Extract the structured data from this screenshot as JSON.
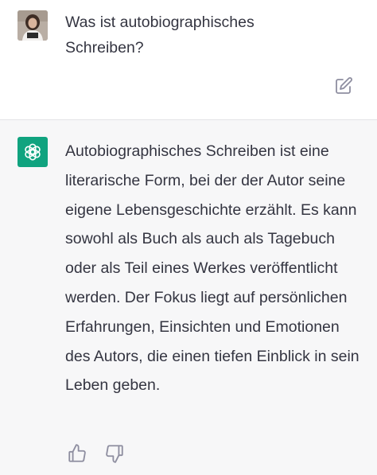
{
  "conversation": {
    "user_message": {
      "text": "Was ist autobiographisches\nSchreiben?",
      "avatar_icon": "user-photo-avatar",
      "edit_icon": "pencil-square-icon"
    },
    "assistant_message": {
      "text": "Autobiographisches Schreiben ist eine literarische Form, bei der der Autor seine eigene Lebensgeschichte erzählt. Es kann sowohl als Buch als auch als Tagebuch oder als Teil eines Werkes veröffentlicht werden. Der Fokus liegt auf persönlichen Erfahrungen, Einsichten und Emotionen des Autors, die einen tiefen Einblick in sein Leben geben.",
      "avatar_icon": "openai-logo-icon",
      "feedback": {
        "like_icon": "thumbs-up-icon",
        "dislike_icon": "thumbs-down-icon"
      }
    }
  },
  "colors": {
    "assistant_background": "#f7f7f8",
    "user_background": "#ffffff",
    "brand_green": "#10a37f",
    "text": "#343541",
    "icon_gray": "#8e8ea0"
  }
}
